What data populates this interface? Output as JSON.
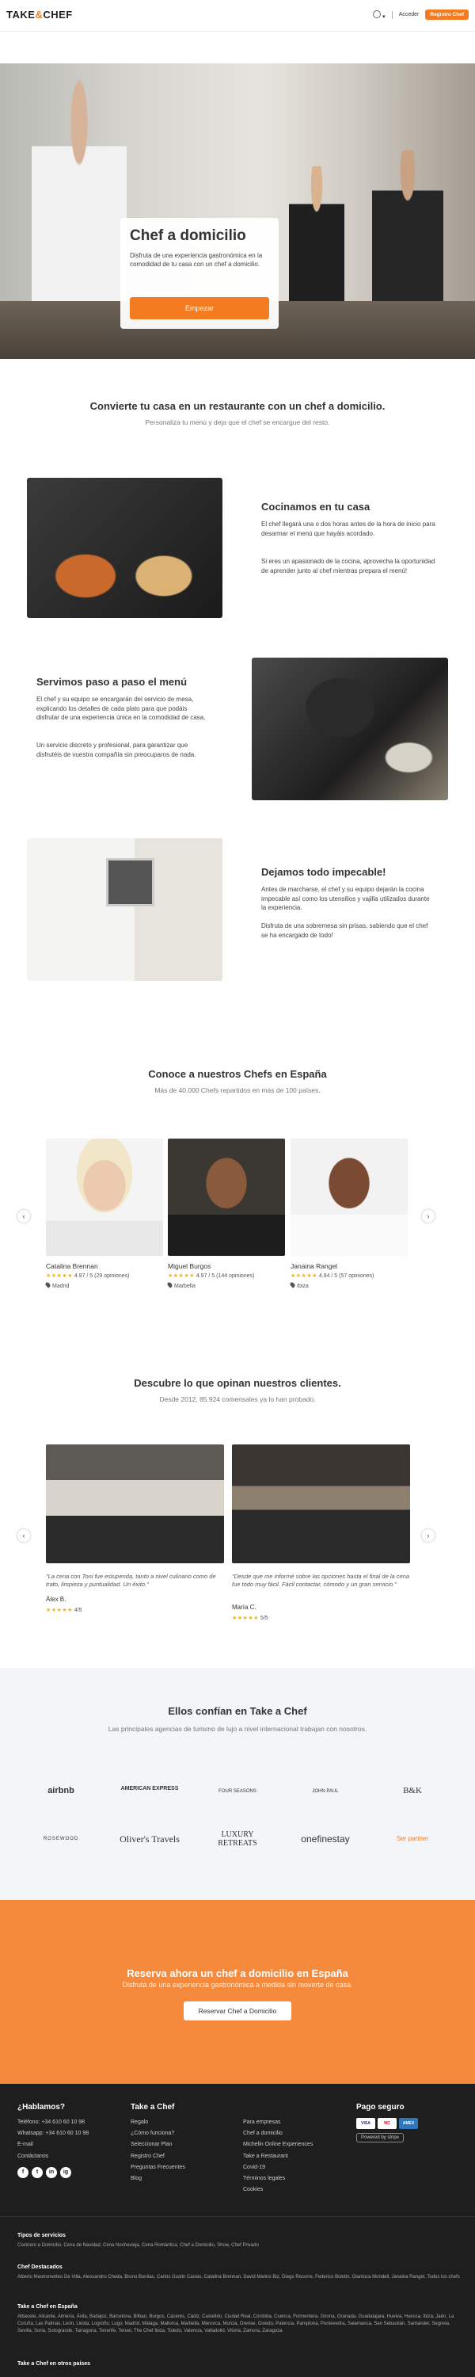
{
  "header": {
    "logo_left": "TAKE",
    "logo_amp": "&",
    "logo_right": "CHEF",
    "lang_caret": "▾",
    "login": "Acceder",
    "register": "Registro Chef"
  },
  "hero": {
    "title": "Chef a domicilio",
    "text": "Disfruta de una experiencia gastronómica en la comodidad de tu casa con un chef a domicilio.",
    "button": "Empezar"
  },
  "intro": {
    "title": "Convierte tu casa en un restaurante con un chef a domicilio.",
    "subtitle": "Personaliza tu menú y deja que el chef se encargue del resto."
  },
  "features": [
    {
      "title": "Cocinamos en tu casa",
      "p1": "El chef llegará una o dos horas antes de la hora de inicio para desarmar el menú que hayáis acordado.",
      "p2": "Si eres un apasionado de la cocina, aprovecha la oportunidad de aprender junto al chef mientras prepara el menú!"
    },
    {
      "title": "Servimos paso a paso el menú",
      "p1": "El chef y su equipo se encargarán del servicio de mesa, explicando los detalles de cada plato para que podáis disfrutar de una experiencia única en la comodidad de casa.",
      "p2": "Un servicio discreto y profesional, para garantizar que disfrutéis de vuestra compañía sin preocuparos de nada."
    },
    {
      "title": "Dejamos todo impecable!",
      "p1": "Antes de marcharse, el chef y su equipo dejarán la cocina impecable así como los utensilios y vajilla utilizados durante la experiencia.",
      "p2": "Disfruta de una sobremesa sin prisas, sabiendo que el chef se ha encargado de todo!"
    }
  ],
  "chefs_section": {
    "title": "Conoce a nuestros Chefs en España",
    "subtitle": "Más de 40.000 Chefs repartidos en más de 100 países.",
    "prev": "‹",
    "next": "›",
    "chefs": [
      {
        "name": "Catalina Brennan",
        "stars": "★★★★★",
        "rating": "4.97 / 5 (29 opiniones)",
        "location": "Madrid"
      },
      {
        "name": "Miguel Burgos",
        "stars": "★★★★★",
        "rating": "4.97 / 5 (144 opiniones)",
        "location": "Marbella"
      },
      {
        "name": "Janaina Rangel",
        "stars": "★★★★★",
        "rating": "4.94 / 5 (57 opiniones)",
        "location": "Ibiza"
      }
    ]
  },
  "reviews_section": {
    "title": "Descubre lo que opinan nuestros clientes.",
    "subtitle": "Desde 2012, 85.924 comensales ya lo han probado.",
    "prev": "‹",
    "next": "›",
    "reviews": [
      {
        "text": "\"La cena con Toni fue estupenda, tanto a nivel culinario como de trato, limpieza y puntualidad. Un éxito.\"",
        "author": "Álex B.",
        "stars": "★★★★★",
        "score": "4/5"
      },
      {
        "text": "\"Desde que me informé sobre las opciones hasta el final de la cena fue todo muy fácil. Fácil contactar, cómodo y un gran servicio.\"",
        "author": "María C.",
        "stars": "★★★★★",
        "score": "5/5"
      }
    ]
  },
  "trust": {
    "title": "Ellos confían en Take a Chef",
    "subtitle": "Las principales agencias de turismo de lujo a nivel internacional trabajan con nosotros.",
    "brands": [
      "airbnb",
      "AMERICAN EXPRESS",
      "FOUR SEASONS",
      "JOHN PAUL",
      "B&K",
      "ROSEWOOD",
      "Oliver's Travels",
      "LUXURY RETREATS",
      "onefinestay",
      "Ser partner"
    ]
  },
  "cta": {
    "title": "Reserva ahora un chef a domicilio en España",
    "subtitle": "Disfruta de una experiencia gastronómica a medida sin moverte de casa.",
    "button": "Reservar Chef a Domicilio"
  },
  "footer": {
    "col1": {
      "title": "¿Hablamos?",
      "items": [
        "Teléfono: +34 610 60 10 98",
        "Whatsapp: +34 610 60 10 98",
        "E-mail",
        "Contáctanos"
      ]
    },
    "col2": {
      "title": "Take a Chef",
      "items": [
        "Regalo",
        "¿Cómo funciona?",
        "Seleccionar Plan",
        "Registro Chef",
        "Preguntas Frecuentes",
        "Blog"
      ]
    },
    "col3": {
      "title": "",
      "items": [
        "Para empresas",
        "Chef a domicilio",
        "Michelin Online Experiences",
        "Take a Restaurant",
        "Covid-19",
        "Términos legales",
        "Cookies"
      ]
    },
    "col4": {
      "title": "Pago seguro",
      "stripe": "Powered by stripe"
    },
    "social": [
      "f",
      "t",
      "in",
      "ig"
    ],
    "pay_cards": [
      "VISA",
      "MC",
      "AMEX"
    ],
    "services_title": "Tipos de servicios",
    "services": "Cocinero a Domicilio, Cena de Navidad, Cena Nochevieja, Cena Romántica, Chef a Domicilio, Show, Chef Privado",
    "chefs_title": "Chef Destacados",
    "chefs": "Alberto Mastrometteo De Villa, Alessandro Cheda, Bruno Bonilas, Carlos Gustin Casias, Catalina Brennan, David Marino Biz, Diego Recorre, Federico Bolotin, Gianluca Mondell, Janaina Rangel, Todos los chefs",
    "cities_title": "Take a Chef en España",
    "cities": "Albacete, Alicante, Almería, Ávila, Badajoz, Barcelona, Bilbao, Burgos, Cáceres, Cádiz, Castellón, Ciudad Real, Córdoba, Cuenca, Formentera, Girona, Granada, Guadalajara, Huelva, Huesca, Ibiza, Jaén, La Coruña, Las Palmas, León, Lleida, Logroño, Lugo, Madrid, Málaga, Mallorca, Marbella, Menorca, Murcia, Orense, Oviedo, Palencia, Pamplona, Pontevedra, Salamanca, San Sebastián, Santander, Segovia, Sevilla, Soria, Sotogrande, Tarragona, Tenerife, Teruel, The Chef Ibiza, Toledo, Valencia, Valladolid, Vitoria, Zamora, Zaragoza",
    "others_title": "Take a Chef en otros países"
  }
}
